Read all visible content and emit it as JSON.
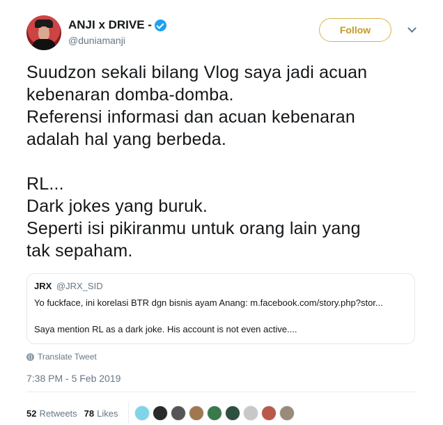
{
  "author": {
    "display_name": "ANJI x DRIVE -",
    "handle": "@duniamanji"
  },
  "follow_label": "Follow",
  "tweet_text": "Suudzon sekali bilang Vlog saya jadi acuan\nkebenaran domba-domba.\nReferensi informasi dan acuan kebenaran\nadalah hal yang berbeda.\n\nRL...\nDark jokes yang buruk.\nSeperti isi pikiranmu untuk orang lain yang\ntak sepaham.",
  "quoted_tweet": {
    "name": "JRX",
    "handle": "@JRX_SID",
    "line1": "Yo fuckface, ini korelasi BTR dgn bisnis ayam Anang: m.facebook.com/story.php?stor...",
    "line2": "Saya mention RL as a dark joke. His account is not even active...."
  },
  "translate_label": "Translate Tweet",
  "timestamp": "7:38 PM - 5 Feb 2019",
  "stats": {
    "retweets_count": "52",
    "retweets_label": "Retweets",
    "likes_count": "78",
    "likes_label": "Likes"
  },
  "likers": [
    {
      "color": "#7fd4e8"
    },
    {
      "color": "#2a2a2a"
    },
    {
      "color": "#555555"
    },
    {
      "color": "#a07850"
    },
    {
      "color": "#3a7a4a"
    },
    {
      "color": "#2f4f3f"
    },
    {
      "color": "#c8c8c8"
    },
    {
      "color": "#b85a4a"
    },
    {
      "color": "#9a8a7a"
    }
  ],
  "colors": {
    "follow_accent": "#c49a23",
    "verified": "#1da1f2",
    "muted_text": "#657786"
  }
}
